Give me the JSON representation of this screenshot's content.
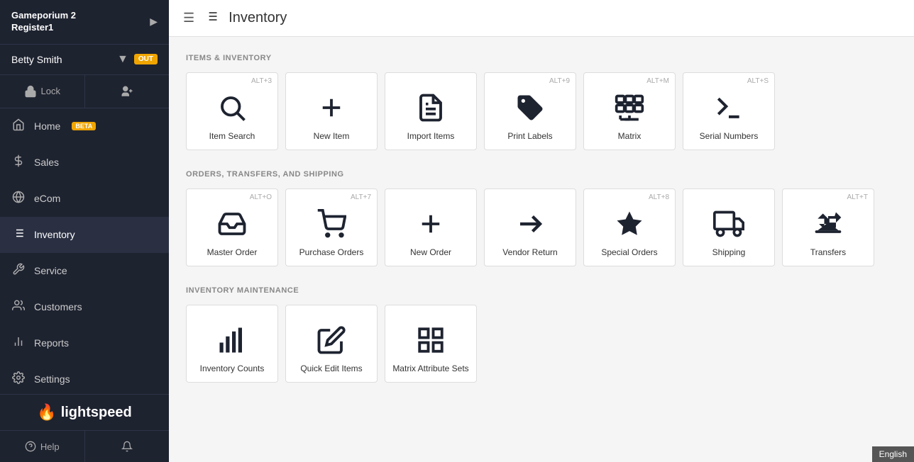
{
  "sidebar": {
    "store_name": "Gameporium 2",
    "register": "Register1",
    "user_name": "Betty Smith",
    "user_status": "OUT",
    "nav_items": [
      {
        "id": "home",
        "label": "Home",
        "icon": "home",
        "badge": "BETA"
      },
      {
        "id": "sales",
        "label": "Sales",
        "icon": "sales"
      },
      {
        "id": "ecom",
        "label": "eCom",
        "icon": "ecom"
      },
      {
        "id": "inventory",
        "label": "Inventory",
        "icon": "inventory",
        "active": true
      },
      {
        "id": "service",
        "label": "Service",
        "icon": "service"
      },
      {
        "id": "customers",
        "label": "Customers",
        "icon": "customers"
      },
      {
        "id": "reports",
        "label": "Reports",
        "icon": "reports"
      },
      {
        "id": "settings",
        "label": "Settings",
        "icon": "settings"
      }
    ],
    "help_label": "Help",
    "logo_text": "lightspeed"
  },
  "topbar": {
    "page_title": "Inventory"
  },
  "sections": [
    {
      "id": "items-inventory",
      "label": "ITEMS & INVENTORY",
      "tiles": [
        {
          "id": "item-search",
          "label": "Item Search",
          "shortcut": "ALT+3",
          "icon": "search"
        },
        {
          "id": "new-item",
          "label": "New Item",
          "shortcut": "",
          "icon": "plus"
        },
        {
          "id": "import-items",
          "label": "Import Items",
          "shortcut": "",
          "icon": "import"
        },
        {
          "id": "print-labels",
          "label": "Print Labels",
          "shortcut": "ALT+9",
          "icon": "label"
        },
        {
          "id": "matrix",
          "label": "Matrix",
          "shortcut": "ALT+M",
          "icon": "matrix"
        },
        {
          "id": "serial-numbers",
          "label": "Serial Numbers",
          "shortcut": "ALT+S",
          "icon": "terminal"
        }
      ]
    },
    {
      "id": "orders-transfers-shipping",
      "label": "ORDERS, TRANSFERS, AND SHIPPING",
      "tiles": [
        {
          "id": "master-order",
          "label": "Master Order",
          "shortcut": "ALT+O",
          "icon": "inbox"
        },
        {
          "id": "purchase-orders",
          "label": "Purchase Orders",
          "shortcut": "ALT+7",
          "icon": "cart"
        },
        {
          "id": "new-order",
          "label": "New Order",
          "shortcut": "",
          "icon": "plus"
        },
        {
          "id": "vendor-return",
          "label": "Vendor Return",
          "shortcut": "",
          "icon": "arrow-right"
        },
        {
          "id": "special-orders",
          "label": "Special Orders",
          "shortcut": "ALT+8",
          "icon": "star"
        },
        {
          "id": "shipping",
          "label": "Shipping",
          "shortcut": "",
          "icon": "truck"
        },
        {
          "id": "transfers",
          "label": "Transfers",
          "shortcut": "ALT+T",
          "icon": "transfers"
        }
      ]
    },
    {
      "id": "inventory-maintenance",
      "label": "INVENTORY MAINTENANCE",
      "tiles": [
        {
          "id": "inventory-counts",
          "label": "Inventory Counts",
          "shortcut": "",
          "icon": "bar-chart"
        },
        {
          "id": "quick-edit-items",
          "label": "Quick Edit Items",
          "shortcut": "",
          "icon": "edit"
        },
        {
          "id": "matrix-attribute-sets",
          "label": "Matrix Attribute Sets",
          "shortcut": "",
          "icon": "grid"
        }
      ]
    }
  ],
  "language": "English"
}
